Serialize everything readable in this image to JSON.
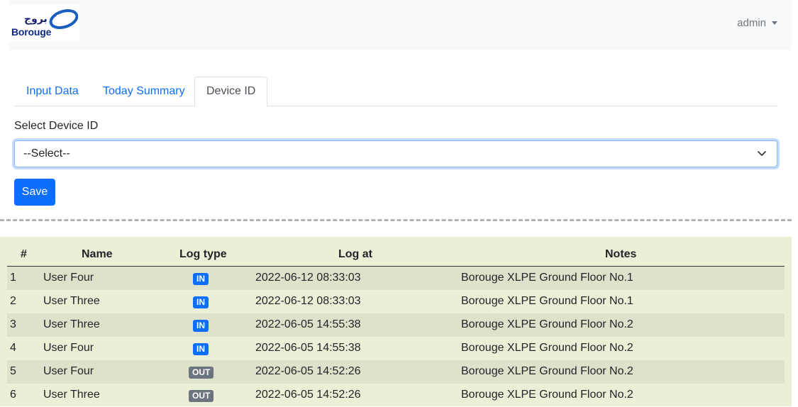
{
  "navbar": {
    "logo_arabic": "بروج",
    "logo_text": "Borouge",
    "user": "admin"
  },
  "tabs": [
    {
      "label": "Input Data",
      "active": false
    },
    {
      "label": "Today Summary",
      "active": false
    },
    {
      "label": "Device ID",
      "active": true
    }
  ],
  "form": {
    "label": "Select Device ID",
    "select_value": "--Select--",
    "save_label": "Save"
  },
  "log": {
    "columns": [
      "#",
      "Name",
      "Log type",
      "Log at",
      "Notes"
    ],
    "rows": [
      {
        "no": "1",
        "name": "User Four",
        "type": "IN",
        "at": "2022-06-12 08:33:03",
        "notes": "Borouge XLPE Ground Floor No.1"
      },
      {
        "no": "2",
        "name": "User Three",
        "type": "IN",
        "at": "2022-06-12 08:33:03",
        "notes": "Borouge XLPE Ground Floor No.1"
      },
      {
        "no": "3",
        "name": "User Three",
        "type": "IN",
        "at": "2022-06-05 14:55:38",
        "notes": "Borouge XLPE Ground Floor No.2"
      },
      {
        "no": "4",
        "name": "User Four",
        "type": "IN",
        "at": "2022-06-05 14:55:38",
        "notes": "Borouge XLPE Ground Floor No.2"
      },
      {
        "no": "5",
        "name": "User Four",
        "type": "OUT",
        "at": "2022-06-05 14:52:26",
        "notes": "Borouge XLPE Ground Floor No.2"
      },
      {
        "no": "6",
        "name": "User Three",
        "type": "OUT",
        "at": "2022-06-05 14:52:26",
        "notes": "Borouge XLPE Ground Floor No.2"
      }
    ]
  },
  "colors": {
    "primary": "#0d6efd",
    "secondary": "#6c757d",
    "log_panel_bg": "#ebefd6"
  },
  "icons": {
    "logo": "borouge-logo-icon",
    "user_caret": "caret-down-icon",
    "select_chevron": "chevron-down-icon"
  }
}
